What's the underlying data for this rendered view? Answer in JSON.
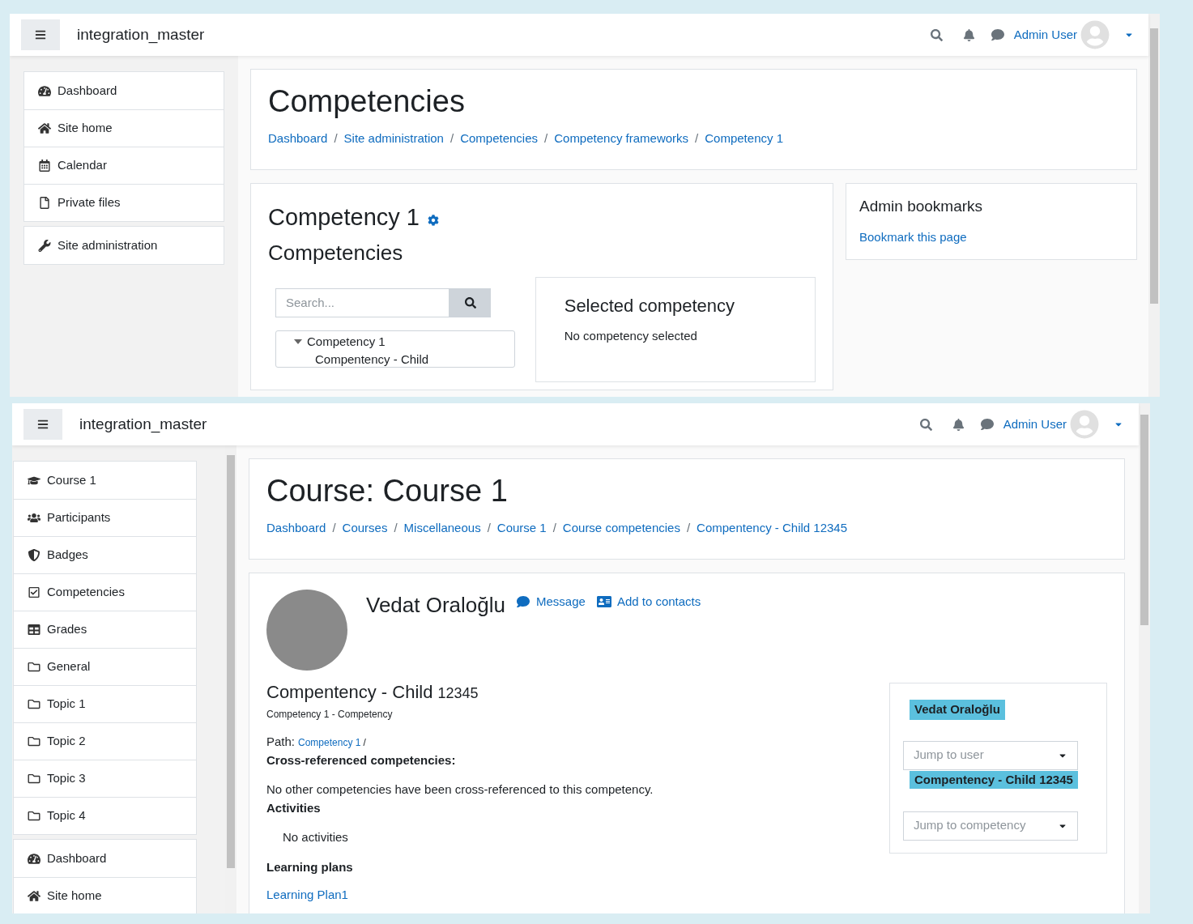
{
  "top_window": {
    "navbar": {
      "site_name": "integration_master",
      "user_name": "Admin User"
    },
    "sidebar": {
      "groups": [
        [
          {
            "kind": "dashboard",
            "label": "Dashboard"
          },
          {
            "kind": "home",
            "label": "Site home"
          },
          {
            "kind": "calendar",
            "label": "Calendar"
          },
          {
            "kind": "file",
            "label": "Private files"
          }
        ],
        [
          {
            "kind": "wrench",
            "label": "Site administration"
          }
        ]
      ]
    },
    "header": {
      "title": "Competencies",
      "breadcrumbs": [
        {
          "label": "Dashboard",
          "separator": "/"
        },
        {
          "label": "Site administration",
          "separator": "/"
        },
        {
          "label": "Competencies",
          "separator": "/"
        },
        {
          "label": "Competency frameworks",
          "separator": "/"
        },
        {
          "label": "Competency 1"
        }
      ]
    },
    "framework": {
      "title": "Competency 1",
      "subtitle": "Competencies",
      "search": {
        "placeholder": "Search..."
      },
      "tree": [
        {
          "label": "Competency 1",
          "expanded": true,
          "children": [
            {
              "label": "Compentency - Child"
            }
          ]
        }
      ],
      "selected_panel": {
        "title": "Selected competency",
        "text": "No competency selected"
      }
    },
    "bookmarks": {
      "title": "Admin bookmarks",
      "link": "Bookmark this page"
    }
  },
  "bottom_window": {
    "navbar": {
      "site_name": "integration_master",
      "user_name": "Admin User"
    },
    "sidebar": {
      "groups": [
        [
          {
            "kind": "graduation",
            "label": "Course 1"
          },
          {
            "kind": "users",
            "label": "Participants"
          },
          {
            "kind": "shield",
            "label": "Badges"
          },
          {
            "kind": "check",
            "label": "Competencies"
          },
          {
            "kind": "table",
            "label": "Grades"
          },
          {
            "kind": "folder",
            "label": "General"
          },
          {
            "kind": "folder",
            "label": "Topic 1"
          },
          {
            "kind": "folder",
            "label": "Topic 2"
          },
          {
            "kind": "folder",
            "label": "Topic 3"
          },
          {
            "kind": "folder",
            "label": "Topic 4"
          }
        ],
        [
          {
            "kind": "dashboard",
            "label": "Dashboard"
          },
          {
            "kind": "home",
            "label": "Site home"
          }
        ]
      ]
    },
    "header": {
      "title": "Course: Course 1",
      "breadcrumbs": [
        {
          "label": "Dashboard",
          "separator": "/"
        },
        {
          "label": "Courses",
          "separator": "/"
        },
        {
          "label": "Miscellaneous",
          "separator": "/"
        },
        {
          "label": "Course 1",
          "separator": "/"
        },
        {
          "label": "Course competencies",
          "separator": "/"
        },
        {
          "label": "Compentency - Child 12345"
        }
      ]
    },
    "user": {
      "name": "Vedat Oraloğlu",
      "actions": [
        {
          "kind": "message",
          "label": "Message"
        },
        {
          "kind": "contact",
          "label": "Add to contacts"
        }
      ]
    },
    "competency": {
      "title": "Compentency - Child",
      "idnumber": "12345",
      "framework": "Competency 1 - Competency",
      "path_label": "Path:",
      "path_link": "Competency 1",
      "path_sep": "/",
      "cross_heading": "Cross-referenced competencies:",
      "cross_text": "No other competencies have been cross-referenced to this competency.",
      "activities_heading": "Activities",
      "activities_text": "No activities",
      "plans_heading": "Learning plans",
      "plans": [
        "Learning Plan1"
      ]
    },
    "navigation": {
      "user_label": "Vedat Oraloğlu",
      "user_select": {
        "placeholder": "Jump to user"
      },
      "competency_label": "Compentency - Child 12345",
      "competency_select": {
        "placeholder": "Jump to competency"
      }
    }
  }
}
